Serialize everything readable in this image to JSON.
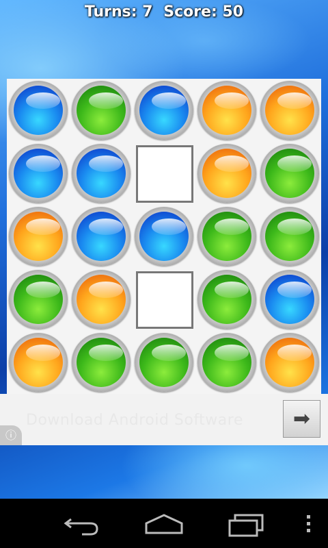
{
  "status": {
    "turns_label": "Turns: 7",
    "score_label": "Score: 50"
  },
  "game": {
    "colors": {
      "blue": "#1a8bf0",
      "green": "#3cb81a",
      "orange": "#ffa51c"
    },
    "grid": [
      [
        "blue",
        "green",
        "blue",
        "orange",
        "orange"
      ],
      [
        "blue",
        "blue",
        "empty",
        "orange",
        "green"
      ],
      [
        "orange",
        "blue",
        "blue",
        "green",
        "green"
      ],
      [
        "green",
        "orange",
        "empty",
        "green",
        "blue"
      ],
      [
        "orange",
        "green",
        "green",
        "green",
        "orange"
      ]
    ]
  },
  "ad": {
    "text": "Download Android Software",
    "info_icon": "info-icon",
    "arrow_icon": "arrow-right-icon"
  },
  "navbar": {
    "back_icon": "back-icon",
    "home_icon": "home-icon",
    "recents_icon": "recents-icon",
    "menu_icon": "overflow-menu-icon"
  }
}
